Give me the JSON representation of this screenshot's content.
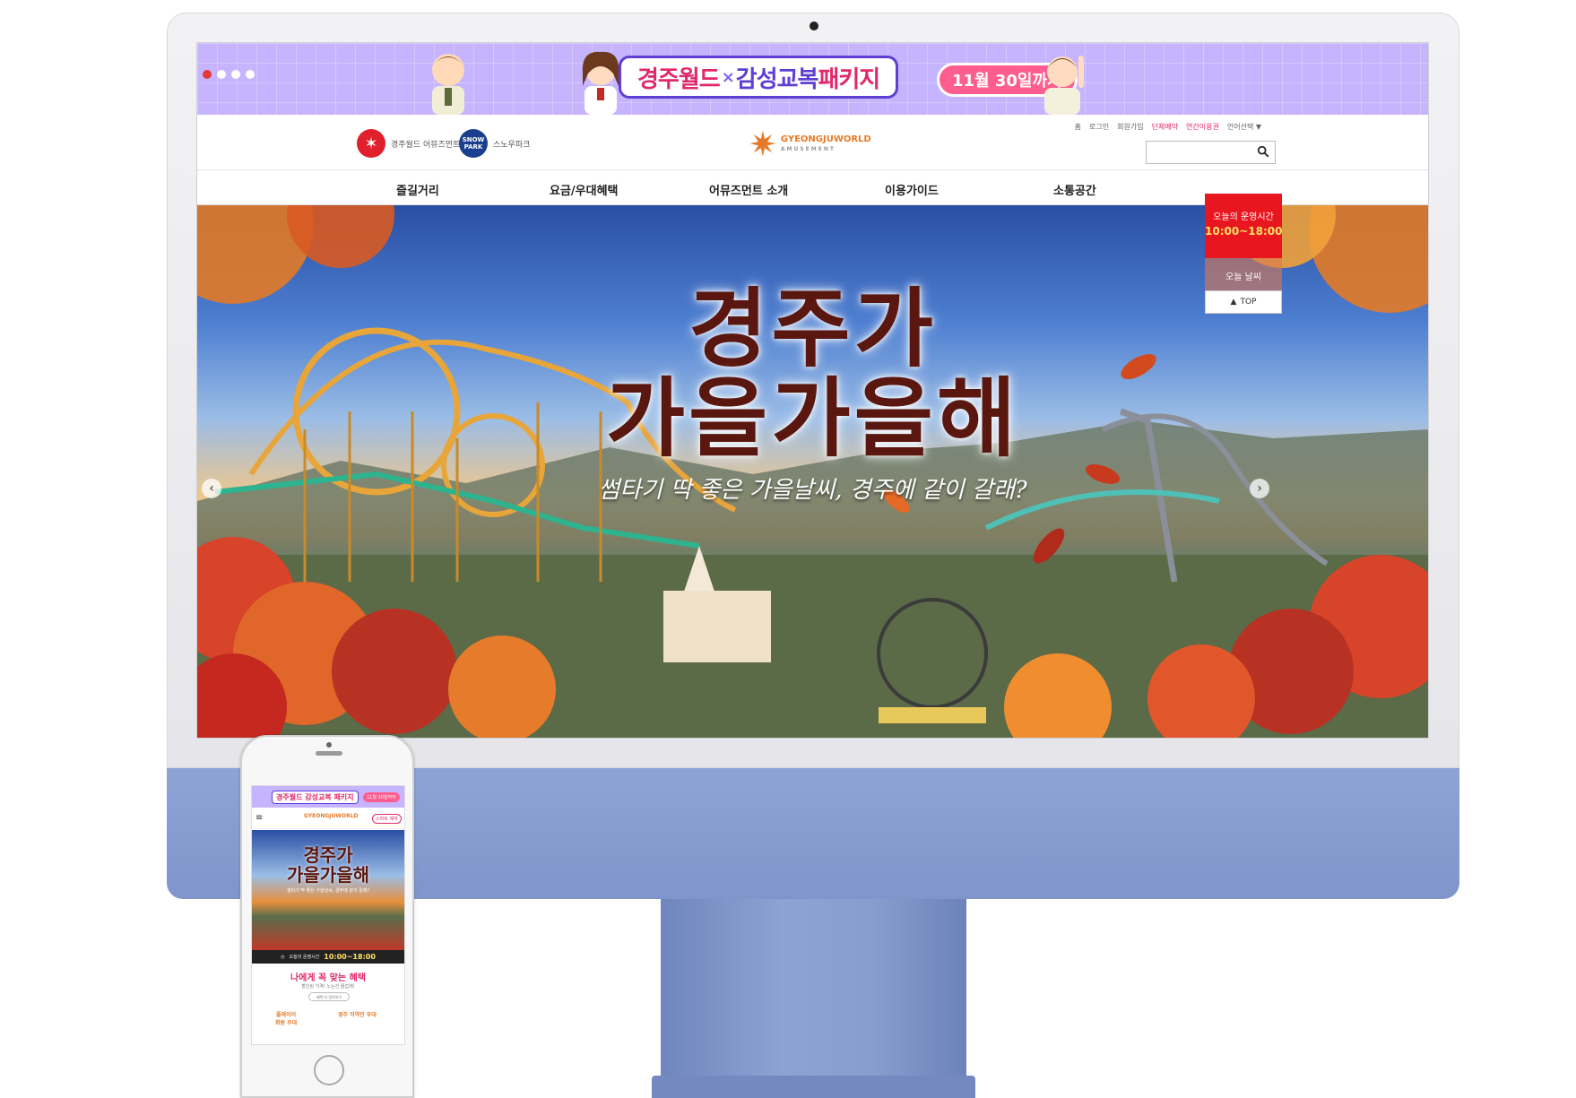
{
  "promo": {
    "title_a": "경주월드",
    "title_x": "×",
    "title_b": "감성교복",
    "title_c": " 패키지",
    "date": "11월 30일까지"
  },
  "header": {
    "brand_amusement": "경주월드 어뮤즈먼트",
    "brand_snowpark_logo": "SNOW PARK",
    "brand_snowpark": "스노우파크",
    "main_logo": "GYEONGJUWORLD",
    "main_logo_sub": "AMUSEMENT",
    "util": [
      "홈",
      "로그인",
      "회원가입",
      "단체예약",
      "연간이용권",
      "언어선택 ▼"
    ]
  },
  "nav": [
    "즐길거리",
    "요금/우대혜택",
    "어뮤즈먼트 소개",
    "이용가이드",
    "소통공간"
  ],
  "hero": {
    "title1": "경주가",
    "title2": "가을가을해",
    "subtitle": "썸타기 딱 좋은 가을날씨, 경주에 같이 갈래?",
    "prev": "‹",
    "next": "›"
  },
  "side": {
    "hours_label": "오늘의 운영시간",
    "hours": "10:00~18:00",
    "caption": "오늘 날씨",
    "top": "TOP"
  },
  "mobile": {
    "promo_title": "경주월드 감성교복 패키지",
    "promo_date": "11월 30일까지",
    "menu": "≡",
    "logo": "GYEONGJUWORLD",
    "btn": "스마트 예약",
    "hero_t1": "경주가",
    "hero_t2": "가을가을해",
    "hero_sub": "썸타기 딱 좋은 가을날씨, 경주에 같이 갈래?",
    "hours_label": "오늘의 운영시간",
    "hours": "10:00~18:00",
    "benefit_title": "나에게 꼭 맞는 혜택",
    "benefit_sub": "할인된 가격! 노는건 즐겁게!",
    "benefit_btn": "혜택 더 알아보기",
    "card1_l1": "플레이어",
    "card1_l2": "회원 우대",
    "card2_l1": "경주 지역민 우대"
  },
  "colors": {
    "accent": "#e0286b",
    "promo_bg": "#c7b4ff",
    "red": "#e8171f",
    "imac": "#8ea3d6"
  }
}
